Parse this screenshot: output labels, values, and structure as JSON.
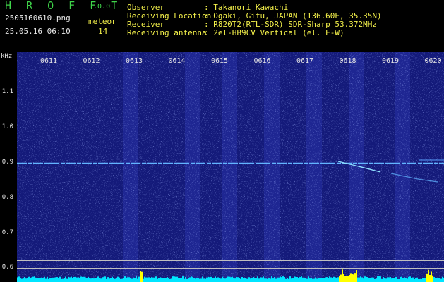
{
  "header": {
    "app_title": "H R O F F T",
    "app_version": "1.0.0",
    "file_name": "2505160610.png",
    "date_time": "25.05.16 06:10",
    "meteor_label": "meteor",
    "meteor_count": "14",
    "observer_label": "Observer",
    "observer_value": ": Takanori Kawachi",
    "location_label": "Receiving Location",
    "location_value": ": Ogaki, Gifu, JAPAN (136.60E, 35.35N)",
    "receiver_label": "Receiver",
    "receiver_value": ": R820T2(RTL-SDR) SDR-Sharp 53.372MHz",
    "antenna_label": "Receiving antenna",
    "antenna_value": ": 2el-HB9CV Vertical (el. E-W)"
  },
  "axis": {
    "unit": "kHz",
    "y_ticks": [
      "1.1",
      "1.0",
      "0.9",
      "0.8",
      "0.7",
      "0.6"
    ],
    "x_ticks": [
      "0611",
      "0612",
      "0613",
      "0614",
      "0615",
      "0616",
      "0617",
      "0618",
      "0619",
      "0620"
    ]
  },
  "colors": {
    "background": "#000000",
    "spectrogram": "#1a1f8c",
    "carrier_line": "#5fb0ff",
    "signal_bars": "#00e5ff",
    "meteor_burst": "#ffff00",
    "header_green": "#3fd44a"
  }
}
